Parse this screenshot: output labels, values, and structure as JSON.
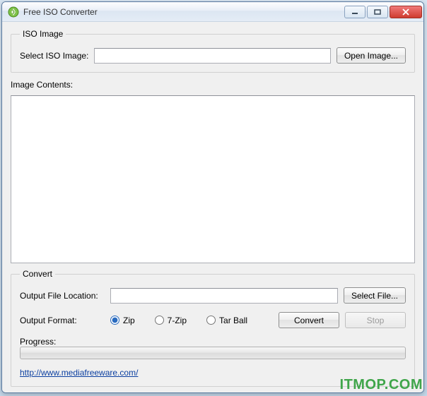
{
  "window": {
    "title": "Free ISO Converter"
  },
  "iso_group": {
    "legend": "ISO Image",
    "select_label": "Select ISO Image:",
    "input_value": "",
    "open_button": "Open Image..."
  },
  "contents": {
    "label": "Image Contents:"
  },
  "convert_group": {
    "legend": "Convert",
    "output_location_label": "Output File Location:",
    "output_location_value": "",
    "select_file_button": "Select File...",
    "output_format_label": "Output Format:",
    "formats": {
      "zip": "Zip",
      "seven_zip": "7-Zip",
      "tarball": "Tar Ball"
    },
    "convert_button": "Convert",
    "stop_button": "Stop",
    "progress_label": "Progress:",
    "link_text": "http://www.mediafreeware.com/"
  },
  "watermark": "ITMOP.COM"
}
